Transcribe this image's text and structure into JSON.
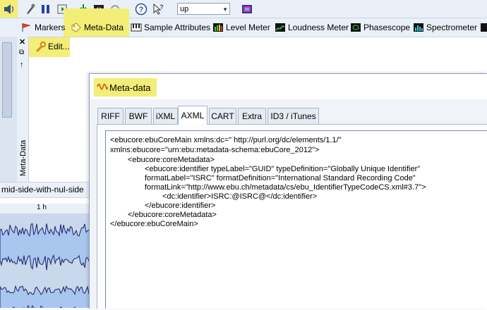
{
  "toolbar": {
    "play_mode_value": "up",
    "icons": [
      "speaker-icon",
      "mute-icon",
      "pause-icon",
      "play-selection-icon",
      "trim-marker-icon",
      "zoom-icon",
      "loop-icon",
      "help-icon",
      "whats-this-icon",
      "spectrum-icon"
    ]
  },
  "tabs": {
    "markers": "Markers",
    "meta_data": "Meta-Data",
    "sample_attributes": "Sample Attributes",
    "level_meter": "Level Meter",
    "loudness_meter": "Loudness Meter",
    "phasescope": "Phasescope",
    "spectrometer": "Spectrometer"
  },
  "panel": {
    "vertical_title": "Meta-Data",
    "edit_label": "Edit..."
  },
  "wave": {
    "file_name": "mid-side-with-nul-side",
    "ruler_label": "1 h"
  },
  "dialog": {
    "title": "Meta-data",
    "tabs": [
      "RIFF",
      "BWF",
      "iXML",
      "AXML",
      "CART",
      "Extra",
      "ID3 / iTunes"
    ],
    "active_tab": "AXML",
    "xml_lines": [
      "<ebucore:ebuCoreMain xmlns:dc=\" http://purl.org/dc/elements/1.1/\"",
      "xmlns:ebucore=\"urn:ebu:metadata-schema:ebuCore_2012\">",
      "<ebucore:coreMetadata>",
      "<ebucore:identifier typeLabel=\"GUID\" typeDefinition=\"Globally Unique Identifier\"",
      "formatLabel=\"ISRC\" formatDefinition=\"International Standard Recording Code\"",
      "formatLink=\"http://www.ebu.ch/metadata/cs/ebu_IdentifierTypeCodeCS.xml#3.7\">",
      "<dc:identifier>ISRC:@ISRC@</dc:identifier>",
      "</ebucore:identifier>",
      "</ebucore:coreMetadata>",
      "</ebucore:ebuCoreMain>"
    ]
  },
  "colors": {
    "highlight": "#f3ee77",
    "toolbar_bg": "#eaf0f8",
    "wave_line": "#1a1f6b",
    "wave_fill": "#a9c6ee"
  }
}
